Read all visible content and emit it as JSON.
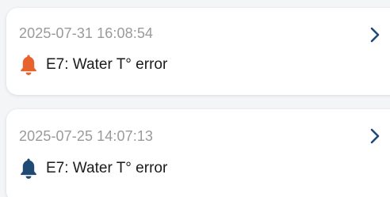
{
  "alarms": [
    {
      "timestamp": "2025-07-31 16:08:54",
      "message": "E7: Water T° error",
      "icon": "bell-icon",
      "icon_color": "#e8632b"
    },
    {
      "timestamp": "2025-07-25 14:07:13",
      "message": "E7: Water T° error",
      "icon": "bell-icon",
      "icon_color": "#1f4a74"
    }
  ],
  "colors": {
    "chevron": "#1f4a74",
    "timestamp_text": "#9a9a9a",
    "message_text": "#1b1b1b",
    "card_background": "#ffffff",
    "page_background": "#f4f5f7"
  }
}
